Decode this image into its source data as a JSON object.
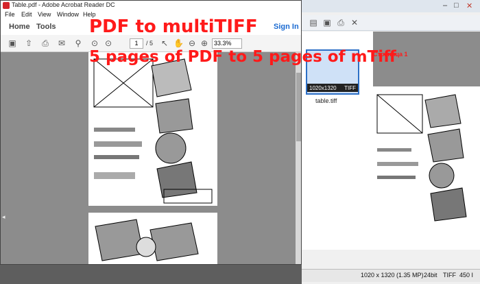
{
  "acrobat": {
    "title": "Table.pdf - Adobe Acrobat Reader DC",
    "menu": [
      "File",
      "Edit",
      "View",
      "Window",
      "Help"
    ],
    "nav": {
      "home": "Home",
      "tools": "Tools",
      "sign_in": "Sign In"
    },
    "toolbar": {
      "page_current": "1",
      "page_total": "/ 5",
      "zoom": "33.3%"
    }
  },
  "viewer": {
    "thumb_caption": {
      "size": "1020x1320",
      "format": "TIFF"
    },
    "thumb_filename": "table.tiff",
    "page_label": "Страница 1",
    "status": {
      "dims": "1020 x 1320 (1.35 MP)",
      "bits": "24bit",
      "format": "TIFF",
      "extra": "450 I"
    }
  },
  "overlay": {
    "line1": "PDF to multiTIFF",
    "line2": "5 pages of PDF to 5 pages of mTiff"
  },
  "colors": {
    "overlay": "#ff1a1a",
    "accent": "#2c6fc6",
    "acrobat_red": "#d4252b"
  }
}
